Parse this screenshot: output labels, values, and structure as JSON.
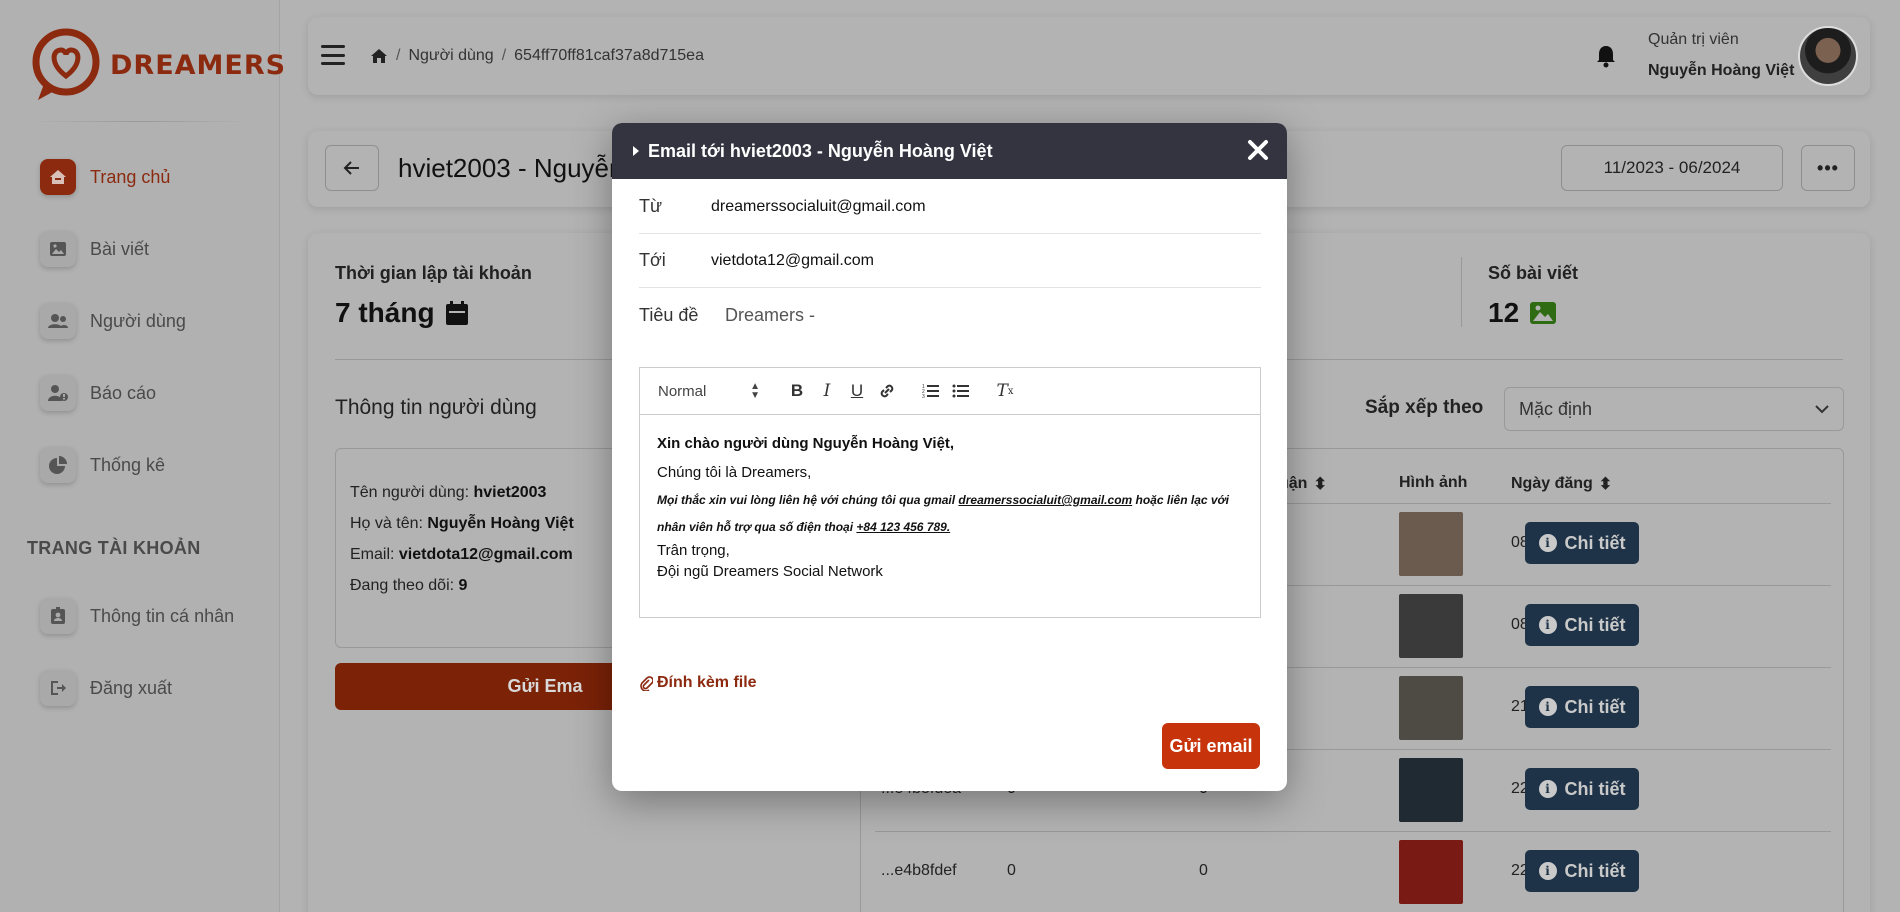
{
  "brand": {
    "name": "DREAMERS",
    "color": "#8c2a10"
  },
  "sidebar": {
    "items": [
      {
        "label": "Trang chủ",
        "icon": "home-icon",
        "active": true
      },
      {
        "label": "Bài viết",
        "icon": "image-icon",
        "active": false
      },
      {
        "label": "Người dùng",
        "icon": "users-icon",
        "active": false
      },
      {
        "label": "Báo cáo",
        "icon": "report-icon",
        "active": false
      },
      {
        "label": "Thống kê",
        "icon": "chart-icon",
        "active": false
      }
    ],
    "section_title": "TRANG TÀI KHOẢN",
    "account_items": [
      {
        "label": "Thông tin cá nhân",
        "icon": "id-card-icon"
      },
      {
        "label": "Đăng xuất",
        "icon": "logout-icon"
      }
    ]
  },
  "topbar": {
    "breadcrumb": [
      "Người dùng",
      "654ff70ff81caf37a8d715ea"
    ],
    "role": "Quản trị viên",
    "user_name": "Nguyễn Hoàng Việt"
  },
  "header": {
    "title": "hviet2003 - Nguyễn",
    "date_range": "11/2023 - 06/2024",
    "more_label": "•••"
  },
  "stats": {
    "account_age_label": "Thời gian lập tài khoản",
    "account_age_value": "7 tháng",
    "post_count_label": "Số bài viết",
    "post_count_value": "12"
  },
  "user_info": {
    "title": "Thông tin người dùng",
    "rows": [
      {
        "label": "Tên người dùng: ",
        "value": "hviet2003"
      },
      {
        "label": "Họ và tên: ",
        "value": "Nguyễn Hoàng Việt"
      },
      {
        "label": "Email: ",
        "value": "vietdota12@gmail.com"
      },
      {
        "label": "Đang theo dõi: ",
        "value": "9"
      }
    ],
    "send_button": "Gửi Ema"
  },
  "sort": {
    "label": "Sắp xếp theo",
    "value": "Mặc định"
  },
  "table": {
    "headers": [
      "uận",
      "Hình ảnh",
      "Ngày đăng"
    ],
    "rows": [
      {
        "id": "",
        "c1": "",
        "c2": "",
        "date": "08/12/2023",
        "thumb": "#6b5a4e"
      },
      {
        "id": "",
        "c1": "",
        "c2": "",
        "date": "08/12/2023",
        "thumb": "#3a3a3a"
      },
      {
        "id": "",
        "c1": "",
        "c2": "",
        "date": "21/12/2023",
        "thumb": "#4e4a44"
      },
      {
        "id": "...e4b8fdea",
        "c1": "0",
        "c2": "0",
        "date": "22/12/2023",
        "thumb": "#1f2a33"
      },
      {
        "id": "...e4b8fdef",
        "c1": "0",
        "c2": "0",
        "date": "22/12/2023",
        "thumb": "#7a1a14"
      }
    ],
    "detail_label": "Chi tiết"
  },
  "modal": {
    "title": "Email tới hviet2003 - Nguyễn Hoàng Việt",
    "from_label": "Từ",
    "from_value": "dreamerssocialuit@gmail.com",
    "to_label": "Tới",
    "to_value": "vietdota12@gmail.com",
    "subject_label": "Tiêu đề",
    "subject_value": "Dreamers - ",
    "editor": {
      "format_select": "Normal",
      "greeting": "Xin chào người dùng Nguyễn Hoàng Việt,",
      "intro": "Chúng tôi là Dreamers,",
      "contact_line_1": "Mọi thắc xin vui lòng liên hệ với chúng tôi qua gmail ",
      "contact_email": "dreamerssocialuit@gmail.com",
      "contact_line_2": " hoặc liên lạc với nhân viên hỗ trợ qua số điện thoại ",
      "contact_phone": "+84 123 456 789.",
      "closing": "Trân trọng,",
      "signature": "Đội ngũ Dreamers Social Network"
    },
    "attach_label": "Đính kèm file",
    "send_label": "Gửi email"
  }
}
